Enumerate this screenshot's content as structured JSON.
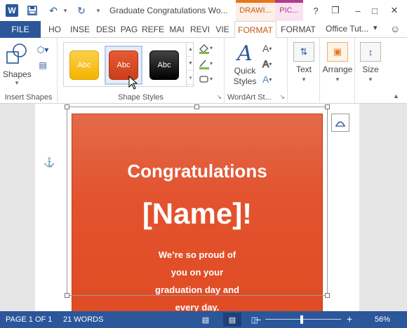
{
  "titlebar": {
    "doc_title": "Graduate Congratulations Wo...",
    "context_drawing": "DRAWI...",
    "context_picture": "PIC...",
    "help": "?",
    "restore": "❒",
    "minimize": "–",
    "maximize": "□",
    "close": "✕"
  },
  "tabs": {
    "file": "FILE",
    "items": [
      "HO",
      "INSE",
      "DESI",
      "PAG",
      "REFE",
      "MAI",
      "REVI",
      "VIE",
      "FORMAT",
      "FORMAT"
    ],
    "account": "Office Tut..."
  },
  "ribbon": {
    "insert_shapes": {
      "shapes_label": "Shapes",
      "group_label": "Insert Shapes"
    },
    "shape_styles": {
      "swatch_text": "Abc",
      "group_label": "Shape Styles"
    },
    "wordart": {
      "quick_styles_label_1": "Quick",
      "quick_styles_label_2": "Styles",
      "group_label": "WordArt St..."
    },
    "text_label": "Text",
    "arrange_label": "Arrange",
    "size_label": "Size"
  },
  "document": {
    "title": "Congratulations",
    "name": "[Name]!",
    "body_lines": [
      "We’re so proud of",
      "you on your",
      "graduation day and",
      "every day."
    ]
  },
  "statusbar": {
    "page": "PAGE 1 OF 1",
    "words": "21 WORDS",
    "zoom_minus": "–",
    "zoom_plus": "+",
    "zoom_level": "56%"
  },
  "colors": {
    "brand_blue": "#2b579a",
    "drawing_context": "#e8771a",
    "picture_context": "#b23c8a",
    "card_orange": "#e2532e"
  }
}
